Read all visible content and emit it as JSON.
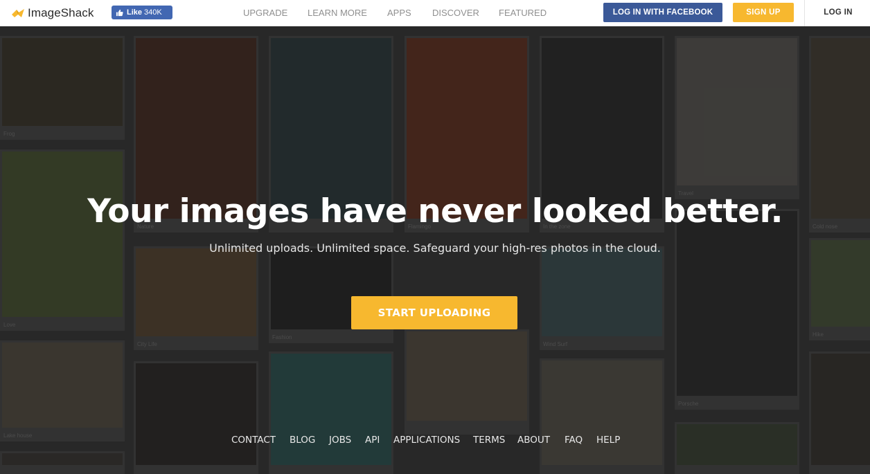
{
  "brand": {
    "name": "ImageShack",
    "accent": "#f7b82f",
    "facebook_blue": "#3b5998"
  },
  "facebook_like": {
    "label": "Like",
    "count": "340K"
  },
  "nav": {
    "links": [
      "UPGRADE",
      "LEARN MORE",
      "APPS",
      "DISCOVER",
      "FEATURED"
    ],
    "facebook_login": "LOG IN WITH FACEBOOK",
    "signup": "SIGN UP",
    "login": "LOG IN"
  },
  "hero": {
    "title": "Your images have never looked better.",
    "subtitle": "Unlimited uploads. Unlimited space. Safeguard your high-res photos in the cloud.",
    "cta": "START UPLOADING"
  },
  "gallery": {
    "captions": [
      "Frog",
      "Nature",
      "Flamingo",
      "In the zone",
      "Travel",
      "Cold nose",
      "Love",
      "City Life",
      "Fashion",
      "Wind Surf",
      "Porsche",
      "Hike",
      "Lake house"
    ]
  },
  "footer": {
    "links": [
      "CONTACT",
      "BLOG",
      "JOBS",
      "API",
      "APPLICATIONS",
      "TERMS",
      "ABOUT",
      "FAQ",
      "HELP"
    ]
  }
}
